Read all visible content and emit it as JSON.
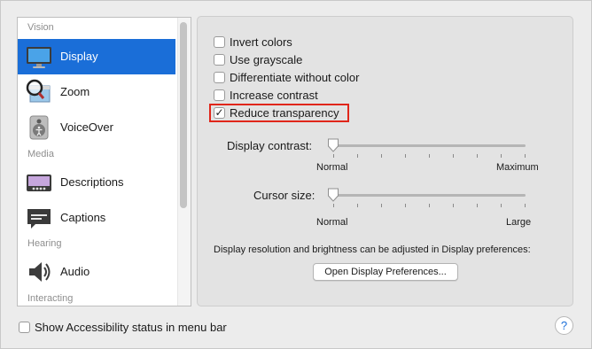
{
  "sidebar": {
    "sections": [
      "Vision",
      "Media",
      "Hearing",
      "Interacting"
    ],
    "items": [
      {
        "label": "Display",
        "icon": "display-icon",
        "selected": true
      },
      {
        "label": "Zoom",
        "icon": "zoom-icon"
      },
      {
        "label": "VoiceOver",
        "icon": "voiceover-icon"
      },
      {
        "label": "Descriptions",
        "icon": "descriptions-icon"
      },
      {
        "label": "Captions",
        "icon": "captions-icon"
      },
      {
        "label": "Audio",
        "icon": "audio-icon"
      }
    ]
  },
  "options": [
    {
      "label": "Invert colors",
      "checked": false
    },
    {
      "label": "Use grayscale",
      "checked": false
    },
    {
      "label": "Differentiate without color",
      "checked": false
    },
    {
      "label": "Increase contrast",
      "checked": false
    },
    {
      "label": "Reduce transparency",
      "checked": true,
      "highlighted": true
    }
  ],
  "sliders": {
    "contrast": {
      "label": "Display contrast:",
      "min_label": "Normal",
      "max_label": "Maximum",
      "value": 0
    },
    "cursor": {
      "label": "Cursor size:",
      "min_label": "Normal",
      "max_label": "Large",
      "value": 0
    }
  },
  "info_text": "Display resolution and brightness can be adjusted in Display preferences:",
  "open_prefs_button": "Open Display Preferences...",
  "status_checkbox": {
    "label": "Show Accessibility status in menu bar",
    "checked": false
  },
  "help_button": "?",
  "colors": {
    "selection": "#1a6ed8",
    "highlight": "#e0261a"
  }
}
